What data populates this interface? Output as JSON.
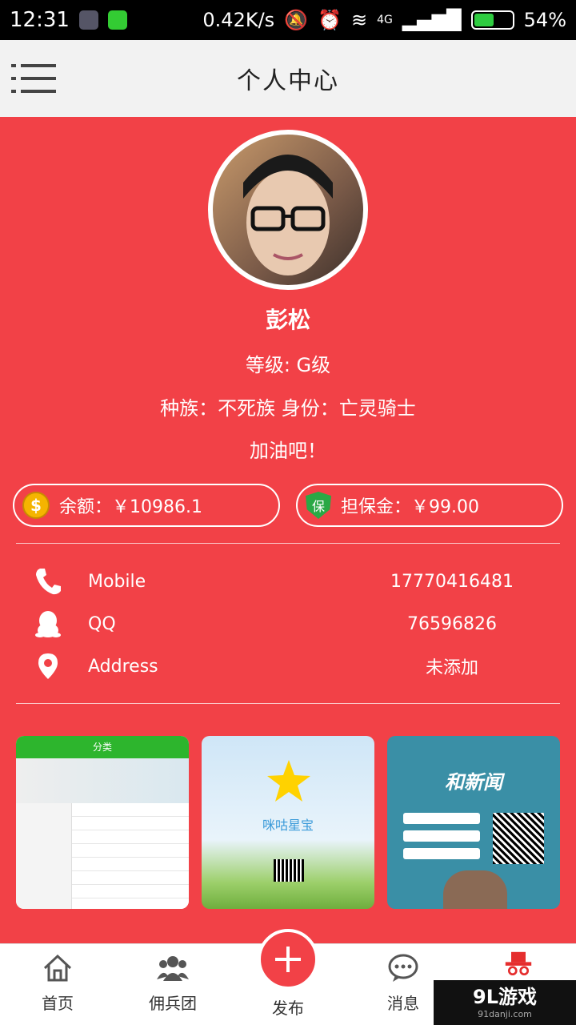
{
  "status_bar": {
    "time": "12:31",
    "net_speed": "0.42K/s",
    "network": "4G",
    "battery": "54%",
    "battery_level": 0.54
  },
  "header": {
    "title": "个人中心"
  },
  "profile": {
    "name": "彭松",
    "level": "等级:  G级",
    "race_identity": "种族：不死族   身份：亡灵骑士",
    "motto": "加油吧！"
  },
  "wallet": {
    "balance": "余额：￥10986.1",
    "deposit": "担保金：￥99.00"
  },
  "contacts": [
    {
      "label": "Mobile",
      "value": "17770416481",
      "icon": "phone-icon"
    },
    {
      "label": "QQ",
      "value": "76596826",
      "icon": "qq-icon"
    },
    {
      "label": "Address",
      "value": "未添加",
      "icon": "location-icon"
    }
  ],
  "thumbnails": [
    {
      "caption": "分类"
    },
    {
      "caption": "咪咕星宝"
    },
    {
      "caption": "和新闻"
    }
  ],
  "tabs": [
    {
      "label": "首页",
      "icon": "home-icon"
    },
    {
      "label": "佣兵团",
      "icon": "group-icon"
    },
    {
      "label": "发布",
      "icon": "plus-icon"
    },
    {
      "label": "消息",
      "icon": "chat-icon"
    }
  ],
  "watermark": {
    "brand": "9L游戏",
    "site": "91danji.com"
  },
  "colors": {
    "primary": "#f24147",
    "header_bg": "#f2f2f2"
  }
}
